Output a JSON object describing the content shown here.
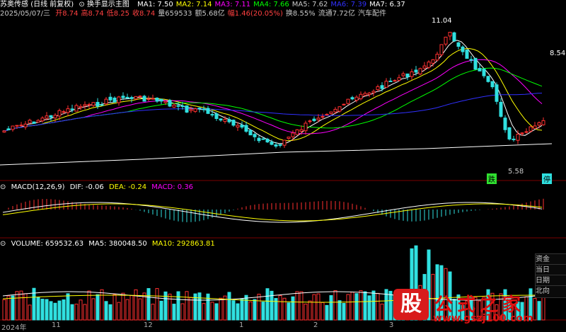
{
  "title_line": {
    "stock": "苏奥传感",
    "mode": "(日线 前复权)",
    "indicator_name": "换手显示主图",
    "ma": [
      {
        "label": "MA1: 7.50",
        "color": "#ffffff"
      },
      {
        "label": "MA2: 7.14",
        "color": "#ffff00"
      },
      {
        "label": "MA3: 7.11",
        "color": "#ff00ff"
      },
      {
        "label": "MA4: 7.66",
        "color": "#00ff00"
      },
      {
        "label": "MA5: 7.62",
        "color": "#c8c8c8"
      },
      {
        "label": "MA6: 7.39",
        "color": "#3030ff"
      },
      {
        "label": "MA7: 6.37",
        "color": "#ffffff"
      }
    ]
  },
  "info_line": {
    "date": "2025/05/07/三",
    "items": [
      {
        "label": "开8.74",
        "color": "#ff4040"
      },
      {
        "label": "高8.74",
        "color": "#ff4040"
      },
      {
        "label": "低8.25",
        "color": "#ff4040"
      },
      {
        "label": "收8.74",
        "color": "#ff4040"
      },
      {
        "label": "量659533",
        "color": "#c8c8c8"
      },
      {
        "label": "额5.68亿",
        "color": "#c8c8c8"
      },
      {
        "label": "幅1.46(20.05%)",
        "color": "#ff4040"
      },
      {
        "label": "换8.55%",
        "color": "#c8c8c8"
      },
      {
        "label": "流通7.72亿",
        "color": "#c8c8c8"
      },
      {
        "label": "汽车配件",
        "color": "#c8c8c8"
      }
    ]
  },
  "macd_header": {
    "name": "MACD(12,26,9)",
    "dif": "DIF: -0.06",
    "dea": "DEA: -0.24",
    "macd": "MACD: 0.36"
  },
  "vol_header": {
    "name": "VOLUME: 659532.63",
    "ma5": "MA5: 380048.50",
    "ma10": "MA10: 292863.81"
  },
  "price_labels": {
    "high_label": "11.04",
    "right_price": "8.546",
    "low_label": "5.58",
    "low_tag": "跌",
    "right_tag": "停"
  },
  "x_axis": [
    "2024年",
    "11",
    "12",
    "1",
    "2",
    "3"
  ],
  "side_panel": [
    "资金",
    "当日",
    "日期",
    "北向"
  ],
  "watermark": {
    "char": "股",
    "text": "公式之家",
    "url": "www.gszj100.com"
  },
  "colors": {
    "up": "#ff3030",
    "down": "#30e0e0",
    "bg": "#000000"
  }
}
